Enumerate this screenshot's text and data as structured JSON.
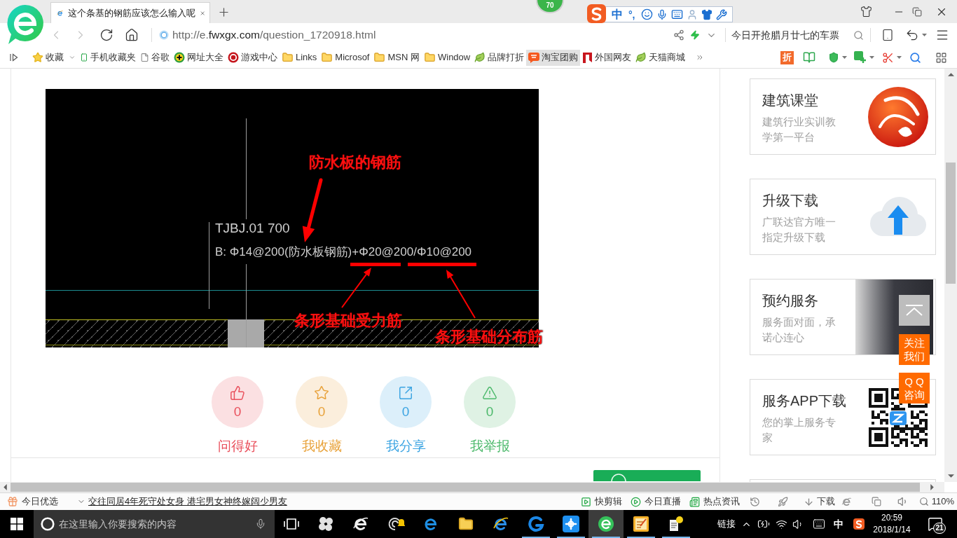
{
  "browser": {
    "tab": {
      "title": "这个条基的钢筋应该怎么输入呢"
    },
    "badge": "70",
    "ime": {
      "mode": "中",
      "punctuation": "°,"
    },
    "url": {
      "scheme": "http://e.",
      "domain": "fwxgx.com",
      "path": "/question_1720918.html"
    },
    "search": {
      "placeholder": "今日开抢腊月廿七的车票"
    }
  },
  "bookmarks": [
    {
      "label": "收藏",
      "kind": "star",
      "hovered": false
    },
    {
      "label": "手机收藏夹",
      "kind": "phone",
      "hovered": false
    },
    {
      "label": "谷歌",
      "kind": "page",
      "hovered": false
    },
    {
      "label": "网址大全",
      "kind": "plus",
      "hovered": false
    },
    {
      "label": "游戏中心",
      "kind": "game",
      "hovered": false
    },
    {
      "label": "Links",
      "kind": "folder",
      "hovered": false
    },
    {
      "label": "Microsof",
      "kind": "folder",
      "hovered": false
    },
    {
      "label": "MSN 网",
      "kind": "folder",
      "hovered": false
    },
    {
      "label": "Window",
      "kind": "folder",
      "hovered": false
    },
    {
      "label": "品牌打折",
      "kind": "leaf",
      "hovered": false
    },
    {
      "label": "淘宝团购",
      "kind": "tao",
      "hovered": true
    },
    {
      "label": "外国网友",
      "kind": "flag",
      "hovered": false
    },
    {
      "label": "天猫商城",
      "kind": "leaf",
      "hovered": false
    }
  ],
  "extensions": {
    "discount": "折"
  },
  "drawing": {
    "title_code": "TJBJ.01 700",
    "rebar_spec": "B: Φ14@200(防水板钢筋)+Φ20@200/Φ10@200",
    "annotations": [
      "防水板的钢筋",
      "条形基础受力筋",
      "条形基础分布筋"
    ]
  },
  "actions": [
    {
      "label": "问得好",
      "count": "0",
      "color": "#e9505c",
      "kind": "like"
    },
    {
      "label": "我收藏",
      "count": "0",
      "color": "#e8a23a",
      "kind": "favorite"
    },
    {
      "label": "我分享",
      "count": "0",
      "color": "#3ba4e2",
      "kind": "share"
    },
    {
      "label": "我举报",
      "count": "0",
      "color": "#4cb96b",
      "kind": "report"
    }
  ],
  "sidebar": {
    "cards": [
      {
        "title": "建筑课堂",
        "subtitle": "建筑行业实训教学第一平台",
        "kind": "logo"
      },
      {
        "title": "升级下载",
        "subtitle": "广联达官方唯一指定升级下载",
        "kind": "cloud"
      },
      {
        "title": "预约服务",
        "subtitle": "服务面对面，承诺心连心",
        "kind": "photo"
      },
      {
        "title": "服务APP下载",
        "subtitle": "您的掌上服务专家",
        "kind": "qr"
      }
    ]
  },
  "floating": {
    "follow": [
      "关注",
      "我们"
    ],
    "consult": [
      "Q Q",
      "咨询"
    ]
  },
  "status_bar": {
    "picks": "今日优选",
    "headline": "交往同居4年死守处女身 港宅男女神终嫁阔少男友",
    "tools": [
      {
        "label": "快剪辑",
        "kind": "clip"
      },
      {
        "label": "今日直播",
        "kind": "live"
      },
      {
        "label": "热点资讯",
        "kind": "news"
      }
    ],
    "download": "下载",
    "zoom": "110%"
  },
  "taskbar": {
    "search": {
      "placeholder": "在这里输入你要搜索的内容"
    },
    "apps": [
      {
        "kind": "pinwheel",
        "running": false,
        "active": false
      },
      {
        "kind": "ie_outline",
        "running": false,
        "active": false
      },
      {
        "kind": "swirl_bell",
        "running": false,
        "active": false
      },
      {
        "kind": "edge",
        "running": false,
        "active": false
      },
      {
        "kind": "folder",
        "running": false,
        "active": false
      },
      {
        "kind": "ie",
        "running": false,
        "active": false
      },
      {
        "kind": "swirl",
        "running": true,
        "active": false
      },
      {
        "kind": "plus_tile",
        "running": true,
        "active": false
      },
      {
        "kind": "browser_e",
        "running": true,
        "active": true
      },
      {
        "kind": "notepad",
        "running": true,
        "active": false
      },
      {
        "kind": "help_doc",
        "running": true,
        "active": false
      }
    ],
    "tray": {
      "link": "链接",
      "ime": "中",
      "time": "20:59",
      "date": "2018/1/14",
      "notifications": "21"
    }
  }
}
